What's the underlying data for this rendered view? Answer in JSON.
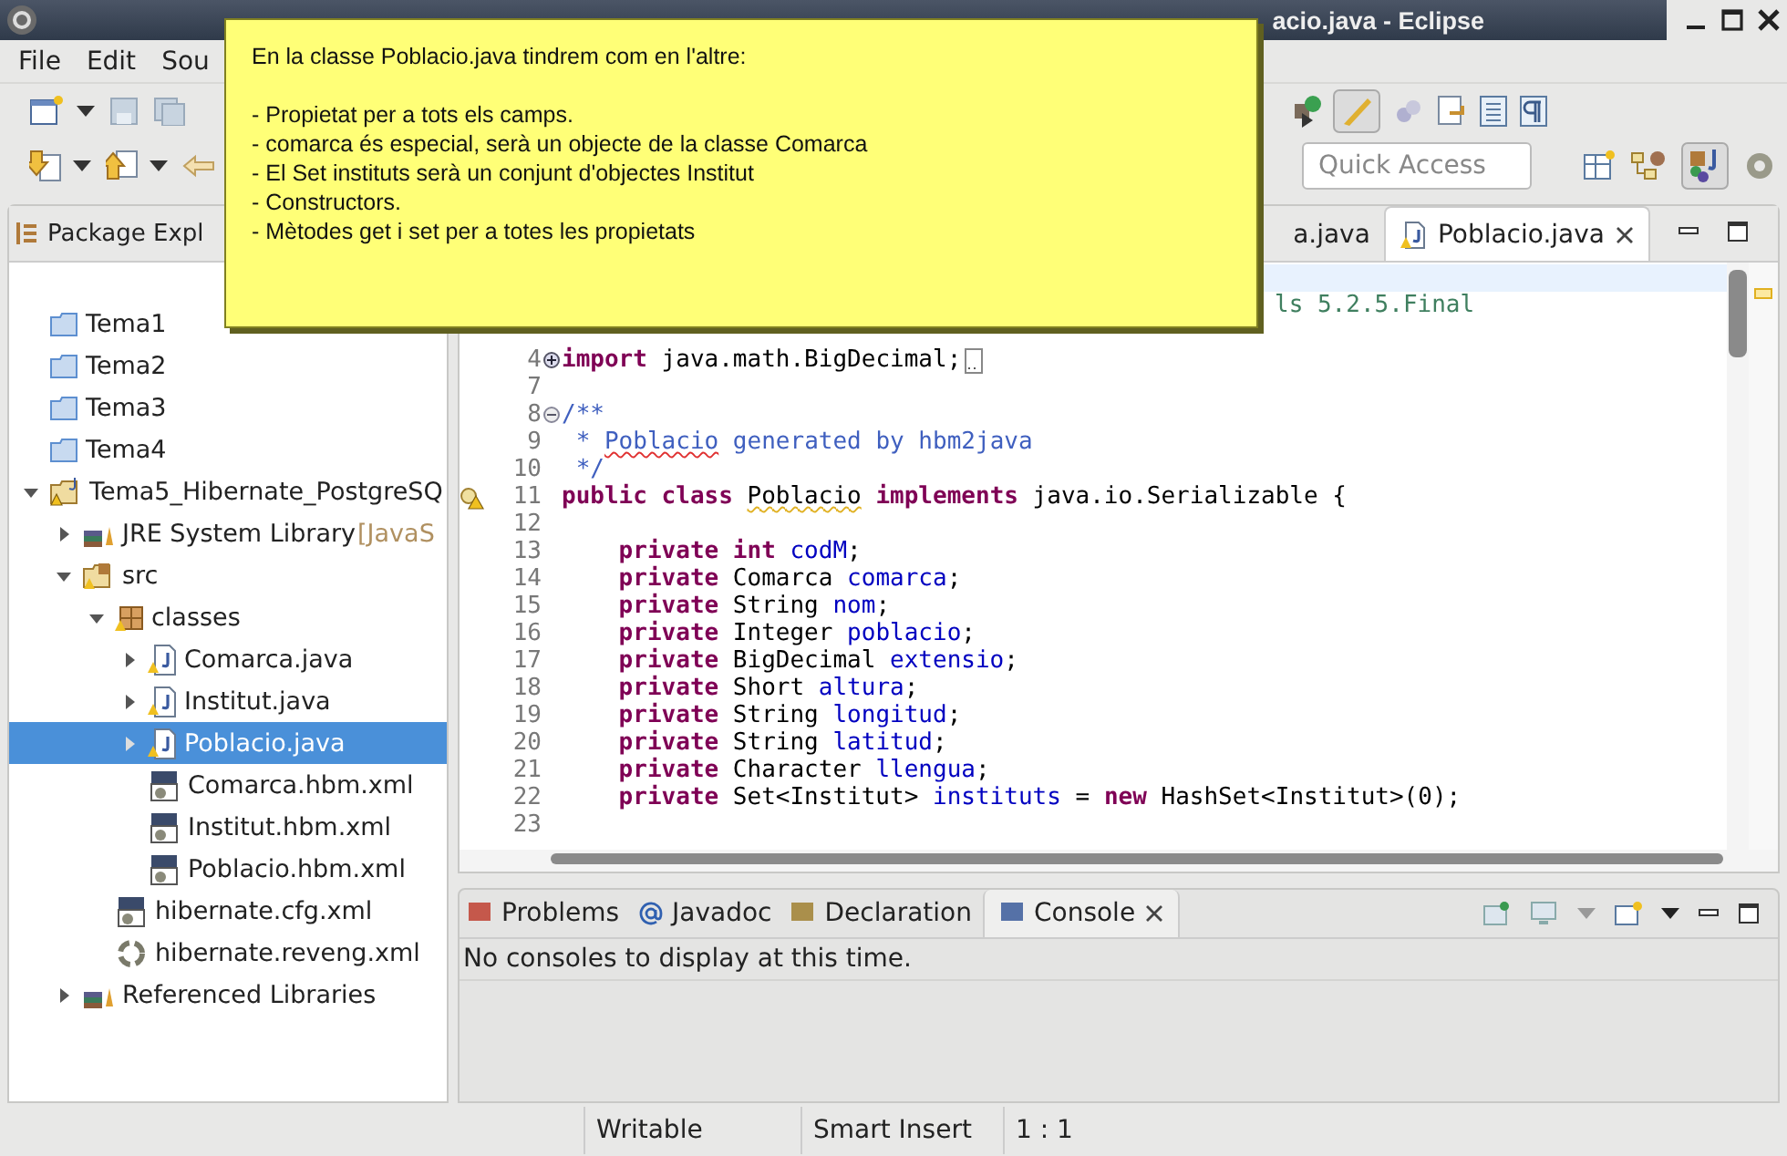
{
  "window": {
    "title": "acio.java - Eclipse"
  },
  "menu": [
    "File",
    "Edit",
    "Sou"
  ],
  "quick_access": {
    "placeholder": "Quick Access"
  },
  "package_explorer": {
    "title": "Package Expl",
    "tree": [
      {
        "label": "Tema1",
        "kind": "folder",
        "selected": false
      },
      {
        "label": "Tema2",
        "kind": "folder",
        "selected": false
      },
      {
        "label": "Tema3",
        "kind": "folder",
        "selected": false
      },
      {
        "label": "Tema4",
        "kind": "folder",
        "selected": false
      },
      {
        "label": "Tema5_Hibernate_PostgreSQ",
        "kind": "project",
        "expanded": true,
        "selected": false,
        "children": [
          {
            "label": "JRE System Library",
            "decoration": "[JavaS",
            "kind": "library",
            "expanded": false,
            "selected": false
          },
          {
            "label": "src",
            "kind": "source",
            "expanded": true,
            "selected": false,
            "children": [
              {
                "label": "classes",
                "kind": "package",
                "expanded": true,
                "selected": false,
                "children": [
                  {
                    "label": "Comarca.java",
                    "kind": "java",
                    "expanded": false,
                    "selected": false
                  },
                  {
                    "label": "Institut.java",
                    "kind": "java",
                    "expanded": false,
                    "selected": false
                  },
                  {
                    "label": "Poblacio.java",
                    "kind": "java",
                    "expanded": false,
                    "selected": true
                  },
                  {
                    "label": "Comarca.hbm.xml",
                    "kind": "xml",
                    "selected": false
                  },
                  {
                    "label": "Institut.hbm.xml",
                    "kind": "xml",
                    "selected": false
                  },
                  {
                    "label": "Poblacio.hbm.xml",
                    "kind": "xml",
                    "selected": false
                  }
                ]
              },
              {
                "label": "hibernate.cfg.xml",
                "kind": "xml",
                "selected": false
              },
              {
                "label": "hibernate.reveng.xml",
                "kind": "reveng",
                "selected": false
              }
            ]
          },
          {
            "label": "Referenced Libraries",
            "kind": "library",
            "expanded": false,
            "selected": false
          }
        ]
      }
    ]
  },
  "editor": {
    "tabs": [
      {
        "label": "a.java",
        "selected": false
      },
      {
        "label": "Poblacio.java",
        "selected": true
      }
    ],
    "lines": [
      {
        "current": true
      },
      {
        "current": false,
        "tokens": [
          {
            "t": "ls 5.2.5.Final",
            "kind": "linecomment"
          }
        ]
      },
      {
        "current": false
      },
      {
        "num": "4",
        "expanded": false,
        "current": false,
        "tokens": [
          {
            "t": "import",
            "kind": "kw"
          },
          {
            "t": " java.math.BigDecimal;",
            "kind": "plain"
          }
        ]
      },
      {
        "num": "7",
        "current": false
      },
      {
        "num": "8",
        "expanded": true,
        "current": false,
        "tokens": [
          {
            "t": "/**",
            "kind": "doc"
          }
        ]
      },
      {
        "num": "9",
        "current": false,
        "tokens": [
          {
            "t": " * ",
            "kind": "doc"
          },
          {
            "t": "Poblacio",
            "kind": "doc",
            "error": true
          },
          {
            "t": " generated by hbm2java",
            "kind": "doc"
          }
        ]
      },
      {
        "num": "10",
        "current": false,
        "tokens": [
          {
            "t": " */",
            "kind": "doc"
          }
        ]
      },
      {
        "num": "11",
        "current": false,
        "warning": true,
        "tokens": [
          {
            "t": "public class ",
            "kind": "kw"
          },
          {
            "t": "Poblacio",
            "kind": "plain",
            "warning": true
          },
          {
            "t": " implements",
            "kind": "kw"
          },
          {
            "t": " java.io.Serializable {",
            "kind": "plain"
          }
        ]
      },
      {
        "num": "12",
        "current": false
      },
      {
        "num": "13",
        "current": false,
        "tokens": [
          {
            "t": "    private int ",
            "kind": "kw"
          },
          {
            "t": "codM",
            "kind": "field"
          },
          {
            "t": ";",
            "kind": "plain"
          }
        ]
      },
      {
        "num": "14",
        "current": false,
        "tokens": [
          {
            "t": "    private",
            "kind": "kw"
          },
          {
            "t": " Comarca ",
            "kind": "plain"
          },
          {
            "t": "comarca",
            "kind": "field"
          },
          {
            "t": ";",
            "kind": "plain"
          }
        ]
      },
      {
        "num": "15",
        "current": false,
        "tokens": [
          {
            "t": "    private",
            "kind": "kw"
          },
          {
            "t": " String ",
            "kind": "plain"
          },
          {
            "t": "nom",
            "kind": "field"
          },
          {
            "t": ";",
            "kind": "plain"
          }
        ]
      },
      {
        "num": "16",
        "current": false,
        "tokens": [
          {
            "t": "    private",
            "kind": "kw"
          },
          {
            "t": " Integer ",
            "kind": "plain"
          },
          {
            "t": "poblacio",
            "kind": "field"
          },
          {
            "t": ";",
            "kind": "plain"
          }
        ]
      },
      {
        "num": "17",
        "current": false,
        "tokens": [
          {
            "t": "    private",
            "kind": "kw"
          },
          {
            "t": " BigDecimal ",
            "kind": "plain"
          },
          {
            "t": "extensio",
            "kind": "field"
          },
          {
            "t": ";",
            "kind": "plain"
          }
        ]
      },
      {
        "num": "18",
        "current": false,
        "tokens": [
          {
            "t": "    private",
            "kind": "kw"
          },
          {
            "t": " Short ",
            "kind": "plain"
          },
          {
            "t": "altura",
            "kind": "field"
          },
          {
            "t": ";",
            "kind": "plain"
          }
        ]
      },
      {
        "num": "19",
        "current": false,
        "tokens": [
          {
            "t": "    private",
            "kind": "kw"
          },
          {
            "t": " String ",
            "kind": "plain"
          },
          {
            "t": "longitud",
            "kind": "field"
          },
          {
            "t": ";",
            "kind": "plain"
          }
        ]
      },
      {
        "num": "20",
        "current": false,
        "tokens": [
          {
            "t": "    private",
            "kind": "kw"
          },
          {
            "t": " String ",
            "kind": "plain"
          },
          {
            "t": "latitud",
            "kind": "field"
          },
          {
            "t": ";",
            "kind": "plain"
          }
        ]
      },
      {
        "num": "21",
        "current": false,
        "tokens": [
          {
            "t": "    private",
            "kind": "kw"
          },
          {
            "t": " Character ",
            "kind": "plain"
          },
          {
            "t": "llengua",
            "kind": "field"
          },
          {
            "t": ";",
            "kind": "plain"
          }
        ]
      },
      {
        "num": "22",
        "current": false,
        "tokens": [
          {
            "t": "    private",
            "kind": "kw"
          },
          {
            "t": " Set<Institut> ",
            "kind": "plain"
          },
          {
            "t": "instituts",
            "kind": "field"
          },
          {
            "t": " = ",
            "kind": "plain"
          },
          {
            "t": "new",
            "kind": "kw"
          },
          {
            "t": " HashSet<Institut>(0);",
            "kind": "plain"
          }
        ]
      },
      {
        "num": "23",
        "current": false
      }
    ]
  },
  "bottom_panel": {
    "tabs": [
      {
        "label": "Problems",
        "kind": "problems",
        "selected": false
      },
      {
        "label": "Javadoc",
        "kind": "javadoc",
        "selected": false
      },
      {
        "label": "Declaration",
        "kind": "declaration",
        "selected": false
      },
      {
        "label": "Console",
        "kind": "console",
        "selected": true
      }
    ],
    "message": "No consoles to display at this time."
  },
  "status_bar": [
    "Writable",
    "Smart Insert",
    "1 : 1"
  ],
  "note": {
    "heading": "En la classe Poblacio.java tindrem com en l'altre:",
    "items": [
      "- Propietat per a tots els camps.",
      "- comarca és especial, serà un objecte de la classe Comarca",
      "- El Set instituts serà un conjunt d'objectes Institut",
      "- Constructors.",
      "- Mètodes get i set per a totes les propietats"
    ]
  }
}
